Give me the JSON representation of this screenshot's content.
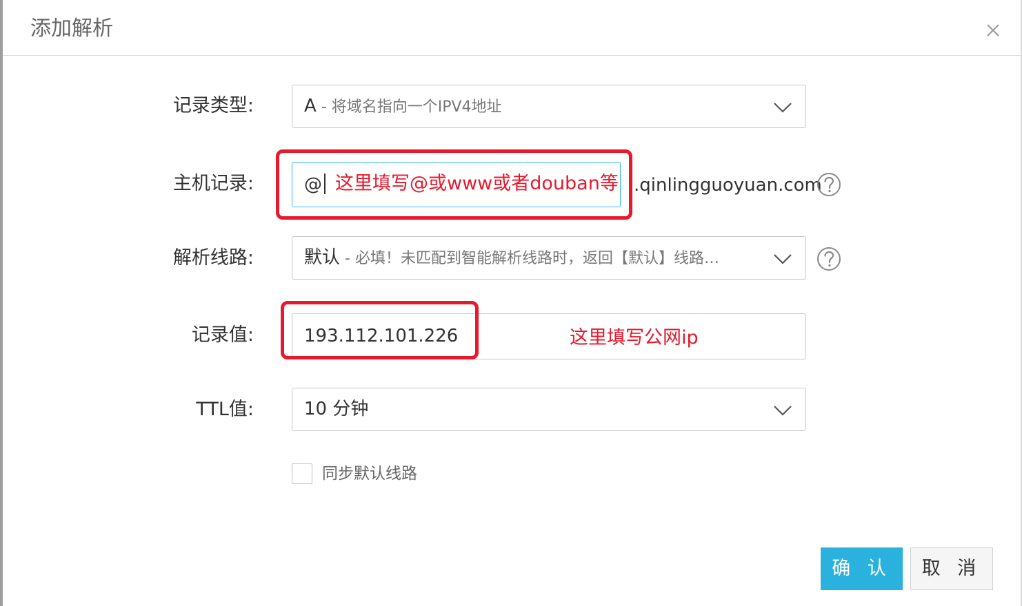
{
  "dialog": {
    "title": "添加解析"
  },
  "form": {
    "record_type": {
      "label": "记录类型:",
      "value": "A",
      "hint": " - 将域名指向一个IPV4地址"
    },
    "host_record": {
      "label": "主机记录:",
      "value": "@",
      "domain_suffix": ".qinlingguoyuan.com",
      "annotation": "这里填写@或www或者douban等"
    },
    "line": {
      "label": "解析线路:",
      "value": "默认",
      "hint": " - 必填！未匹配到智能解析线路时，返回【默认】线路…"
    },
    "record_value": {
      "label": "记录值:",
      "value": "193.112.101.226",
      "annotation": "这里填写公网ip"
    },
    "ttl": {
      "label": "TTL值:",
      "value": "10 分钟"
    },
    "sync_default_line": {
      "label": "同步默认线路",
      "checked": false
    }
  },
  "buttons": {
    "confirm": "确 认",
    "cancel": "取 消"
  },
  "colors": {
    "primary": "#2bb1dd",
    "focus_border": "#2db7f5",
    "annotation_red": "#e8192c"
  },
  "icons": {
    "close": "close-icon",
    "dropdown": "chevron-down-icon",
    "help": "help-icon"
  }
}
